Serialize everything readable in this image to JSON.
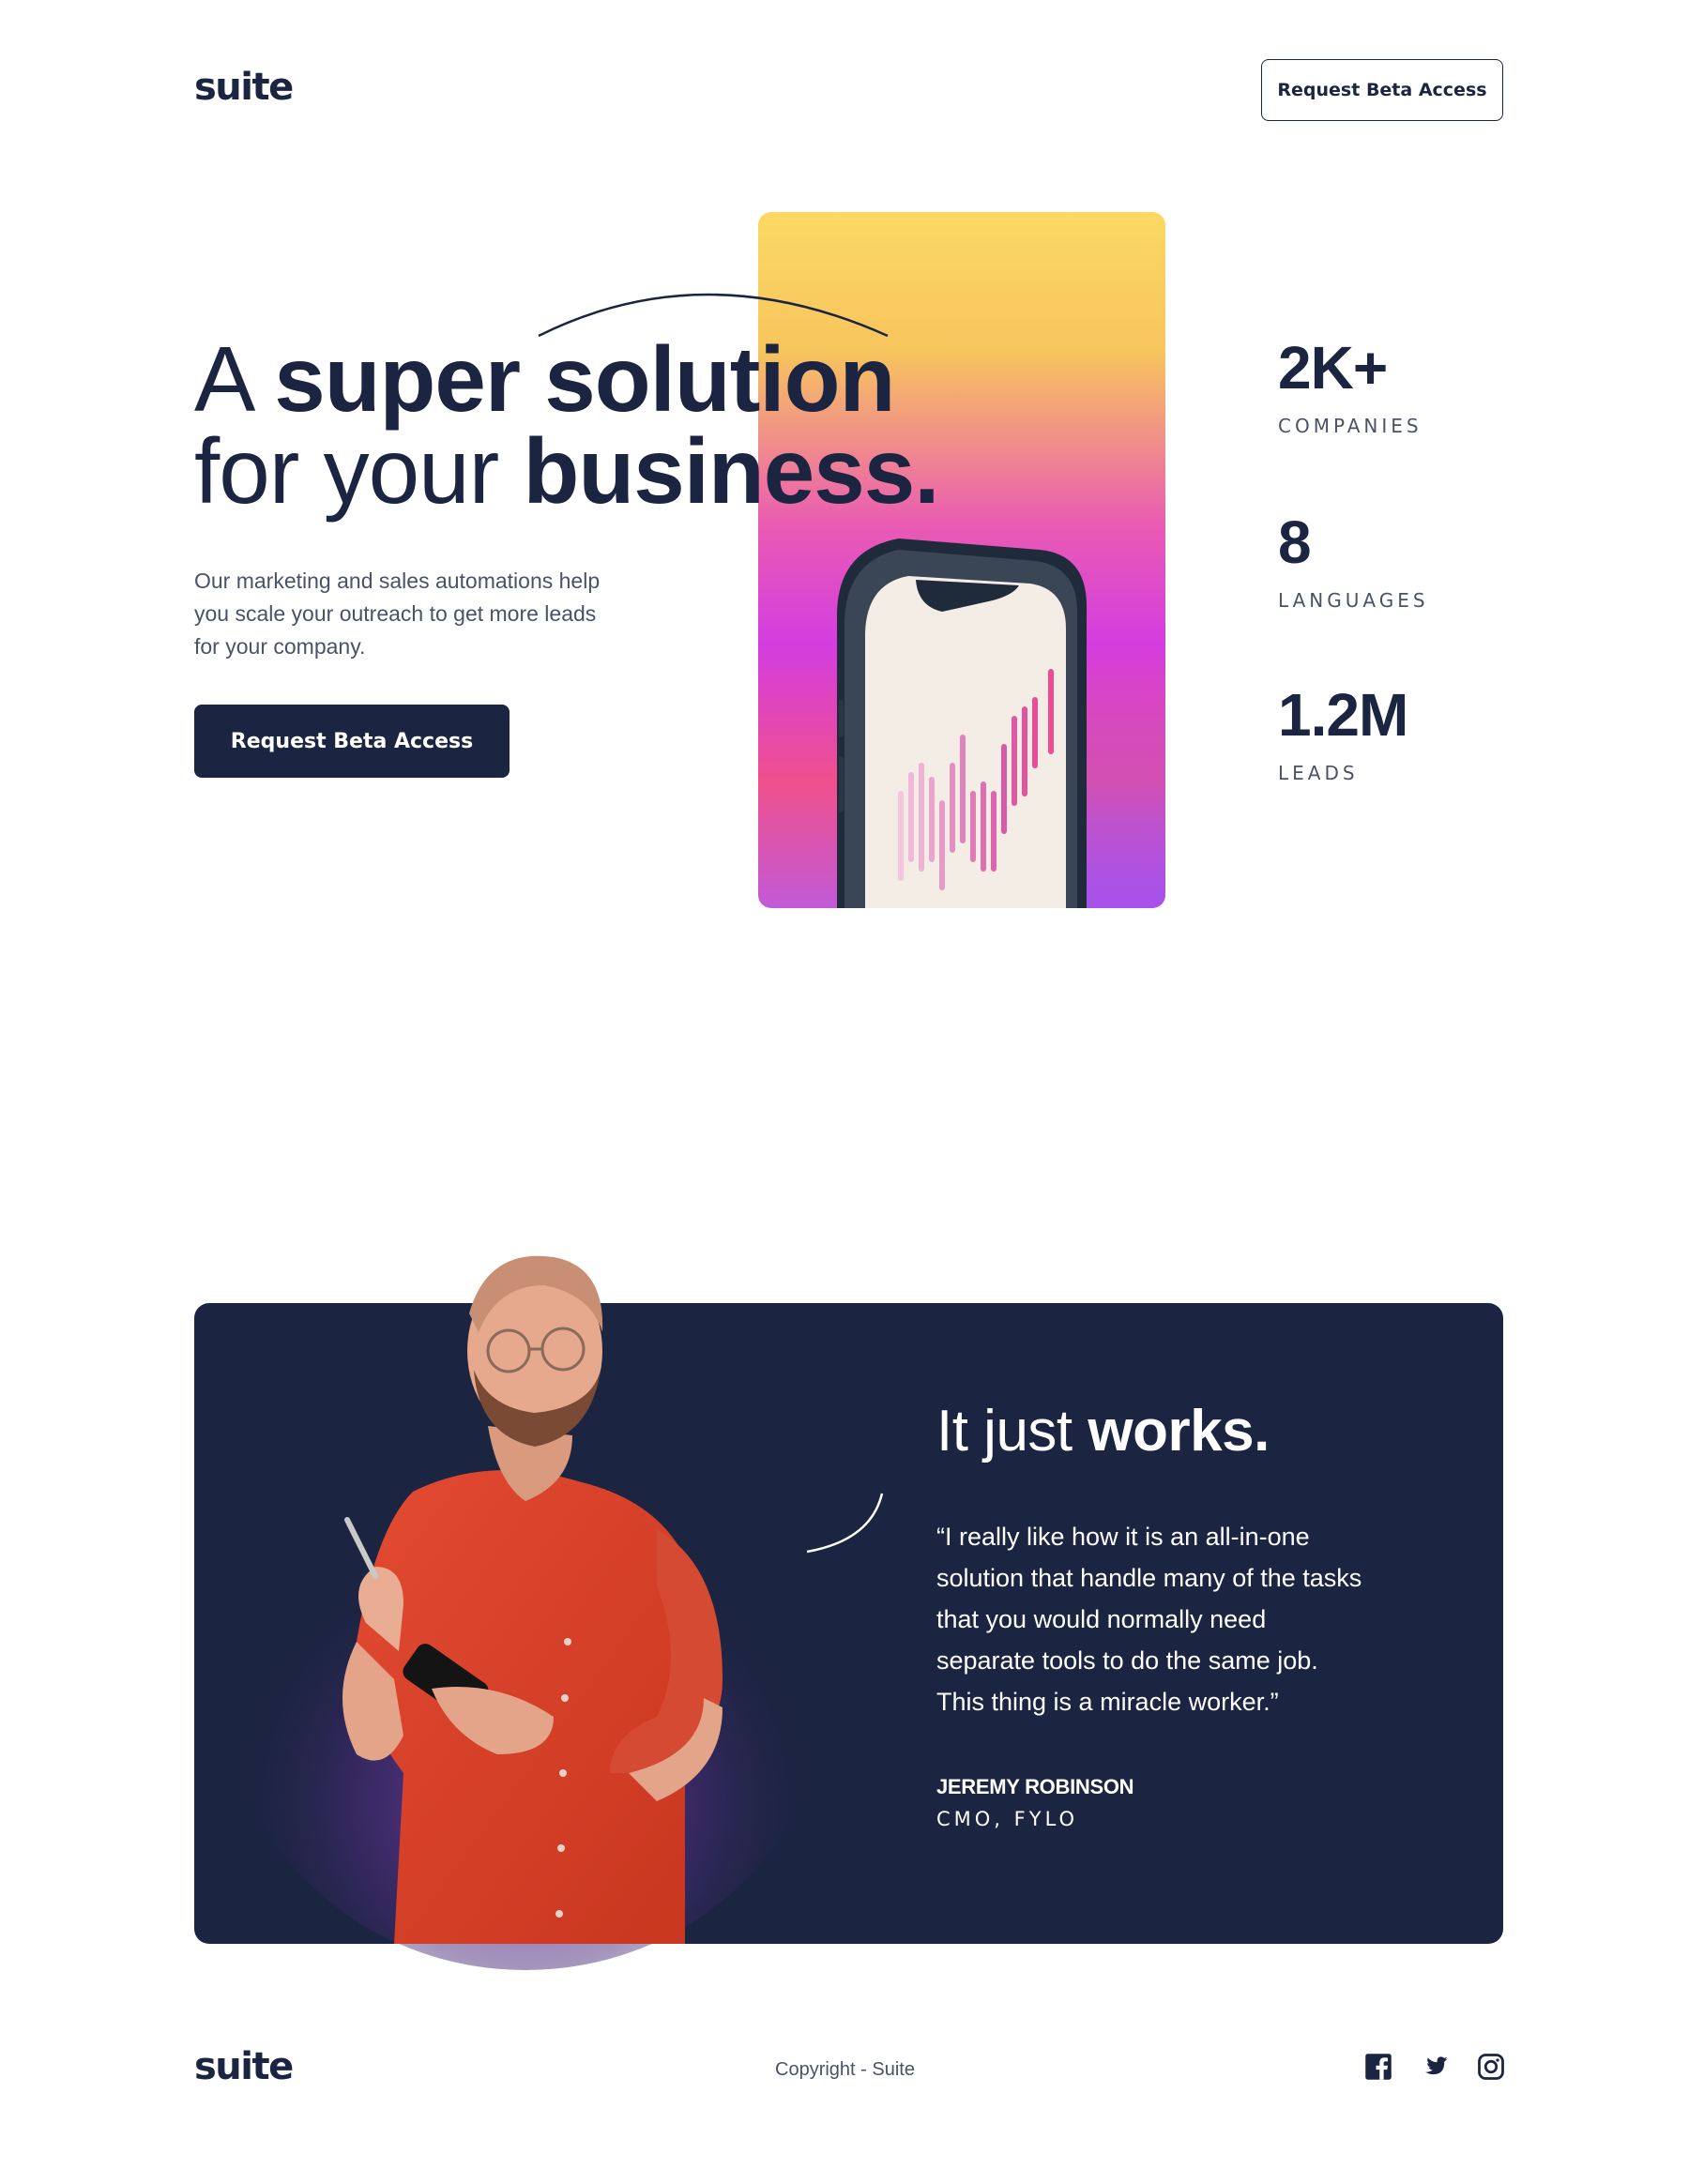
{
  "header": {
    "logo": "suite",
    "cta_label": "Request Beta Access"
  },
  "hero": {
    "title_line1_thin": "A ",
    "title_line1_bold": "super solution",
    "title_line2_thin": "for your ",
    "title_line2_bold": "business.",
    "description": "Our marketing and sales automations help you scale your outreach to get more leads for your company.",
    "cta_label": "Request Beta Access"
  },
  "stats": [
    {
      "value": "2K+",
      "label": "COMPANIES"
    },
    {
      "value": "8",
      "label": "LANGUAGES"
    },
    {
      "value": "1.2M",
      "label": "LEADS"
    }
  ],
  "testimonial": {
    "title_thin": "It just ",
    "title_bold": "works.",
    "quote": "“I really like how it is an all-in-one solution that handle many of the tasks that you would normally need separate tools to do the same job. This thing is a miracle worker.”",
    "name": "JEREMY ROBINSON",
    "role": "CMO, FYLO"
  },
  "footer": {
    "logo": "suite",
    "copyright": "Copyright - Suite",
    "social_icons": [
      "facebook-icon",
      "twitter-icon",
      "instagram-icon"
    ]
  },
  "colors": {
    "navy": "#1b2440",
    "text_muted": "#4b5268",
    "gradient_top": "#fbd964",
    "gradient_mid": "#d33de0",
    "gradient_bottom": "#f0508d"
  }
}
